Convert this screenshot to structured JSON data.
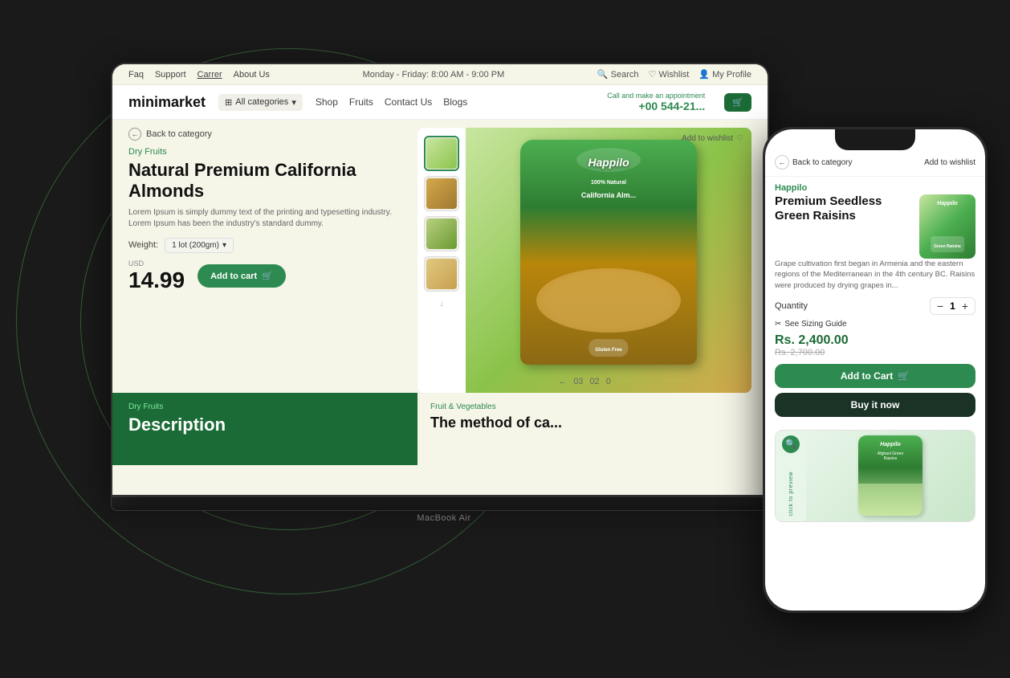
{
  "background": "#1a1a1a",
  "laptop": {
    "label": "MacBook Air",
    "topbar": {
      "links": [
        "Faq",
        "Support",
        "Carrer",
        "About Us"
      ],
      "hours": "Monday - Friday: 8:00 AM - 9:00 PM",
      "right": [
        "Search",
        "Wishlist",
        "My Profile"
      ]
    },
    "nav": {
      "brand": "minimarket",
      "all_categories": "All categories",
      "links": [
        "Shop",
        "Fruits",
        "Contact Us",
        "Blogs"
      ],
      "call_label": "Call and make an appointment",
      "phone": "+00 544-21..."
    },
    "product": {
      "back_label": "Back to category",
      "category": "Dry Fruits",
      "title": "Natural Premium California Almonds",
      "description": "Lorem Ipsum is simply dummy text of the printing and typesetting industry. Lorem Ipsum has been the industry's standard dummy.",
      "weight_label": "Weight:",
      "weight_option": "1 lot (200gm)",
      "price_currency": "USD",
      "price": "14.99",
      "add_to_cart": "Add to cart",
      "wishlist": "Add to wishlist",
      "pagination": [
        "03",
        "02",
        "0"
      ]
    },
    "description": {
      "category": "Dry Fruits",
      "title": "Description",
      "right_category": "Fruit & Vegetables",
      "right_text": "The method of ca..."
    }
  },
  "phone": {
    "back_label": "Back to category",
    "wishlist_label": "Add to wishlist",
    "brand": "Happilo",
    "product_title": "Premium Seedless Green Raisins",
    "product_desc": "Grape cultivation first began in Armenia and the eastern regions of the Mediterranean in the 4th century BC. Raisins were produced by drying grapes in...",
    "quantity_label": "Quantity",
    "quantity_value": "1",
    "sizing_label": "See Sizing Guide",
    "price": "Rs. 2,400.00",
    "price_original": "Rs. 2,700.00",
    "add_to_cart": "Add to Cart",
    "buy_now": "Buy it now",
    "preview": {
      "click_label": "click to preview"
    }
  }
}
